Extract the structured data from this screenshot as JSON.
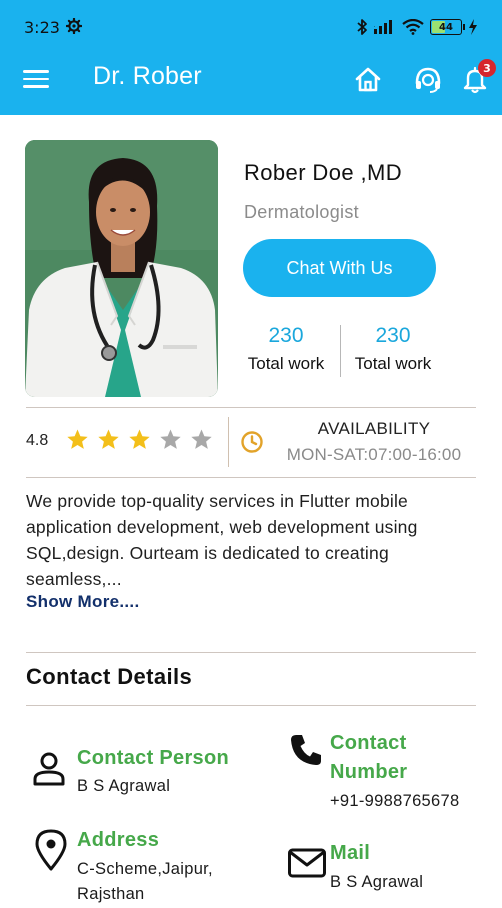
{
  "status_bar": {
    "time": "3:23",
    "battery": "44"
  },
  "app_bar": {
    "title": "Dr. Rober",
    "notification_count": "3",
    "accent_color": "#1ab2ee"
  },
  "profile": {
    "name": "Rober Doe ,MD",
    "specialty": "Dermatologist",
    "chat_button": "Chat With Us",
    "stats": [
      {
        "value": "230",
        "label": "Total work"
      },
      {
        "value": "230",
        "label": "Total work"
      }
    ]
  },
  "rating": {
    "value": "4.8",
    "stars_filled": 3,
    "stars_total": 5
  },
  "availability": {
    "title": "AVAILABILITY",
    "hours": "MON-SAT:07:00-16:00"
  },
  "about": {
    "text": "We provide top-quality services in Flutter mobile application development, web development using SQL,design. Ourteam is  dedicated to creating seamless,...",
    "show_more": "Show More...."
  },
  "contact": {
    "heading": "Contact Details",
    "person": {
      "title": "Contact Person",
      "value": "B S Agrawal"
    },
    "number": {
      "title_line1": "Contact",
      "title_line2": "Number",
      "value": "+91-9988765678"
    },
    "address": {
      "title": "Address",
      "value_line1": "C-Scheme,Jaipur,",
      "value_line2": "Rajsthan"
    },
    "mail": {
      "title": "Mail",
      "value": "B S Agrawal"
    }
  }
}
